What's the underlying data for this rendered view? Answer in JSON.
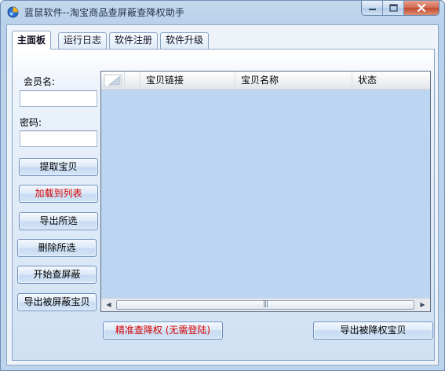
{
  "window": {
    "title": "蓝鼠软件--淘宝商品查屏蔽查降权助手"
  },
  "tabs": [
    {
      "label": "主面板",
      "active": true
    },
    {
      "label": "运行日志",
      "active": false
    },
    {
      "label": "软件注册",
      "active": false
    },
    {
      "label": "软件升级",
      "active": false
    }
  ],
  "login": {
    "member_label": "会员名:",
    "member_value": "",
    "password_label": "密码:",
    "password_value": ""
  },
  "buttons": {
    "fetch": "提取宝贝",
    "load_to_list": "加载到列表",
    "export_selected": "导出所选",
    "delete_selected": "删除所选",
    "start_check": "开始查屏蔽",
    "export_shielded": "导出被屏蔽宝贝",
    "precise_check": "精准查降权 (无需登陆)",
    "export_demoted": "导出被降权宝贝"
  },
  "table": {
    "columns": [
      "宝贝链接",
      "宝贝名称",
      "状态"
    ],
    "rows": []
  },
  "colors": {
    "red_text": "#d40000",
    "list_bg": "#bcd5f1",
    "window_frame": "#b9d1ea"
  },
  "icons": {
    "app": "app-logo-icon",
    "minimize": "minimize-icon",
    "maximize": "maximize-icon",
    "close": "close-icon"
  }
}
